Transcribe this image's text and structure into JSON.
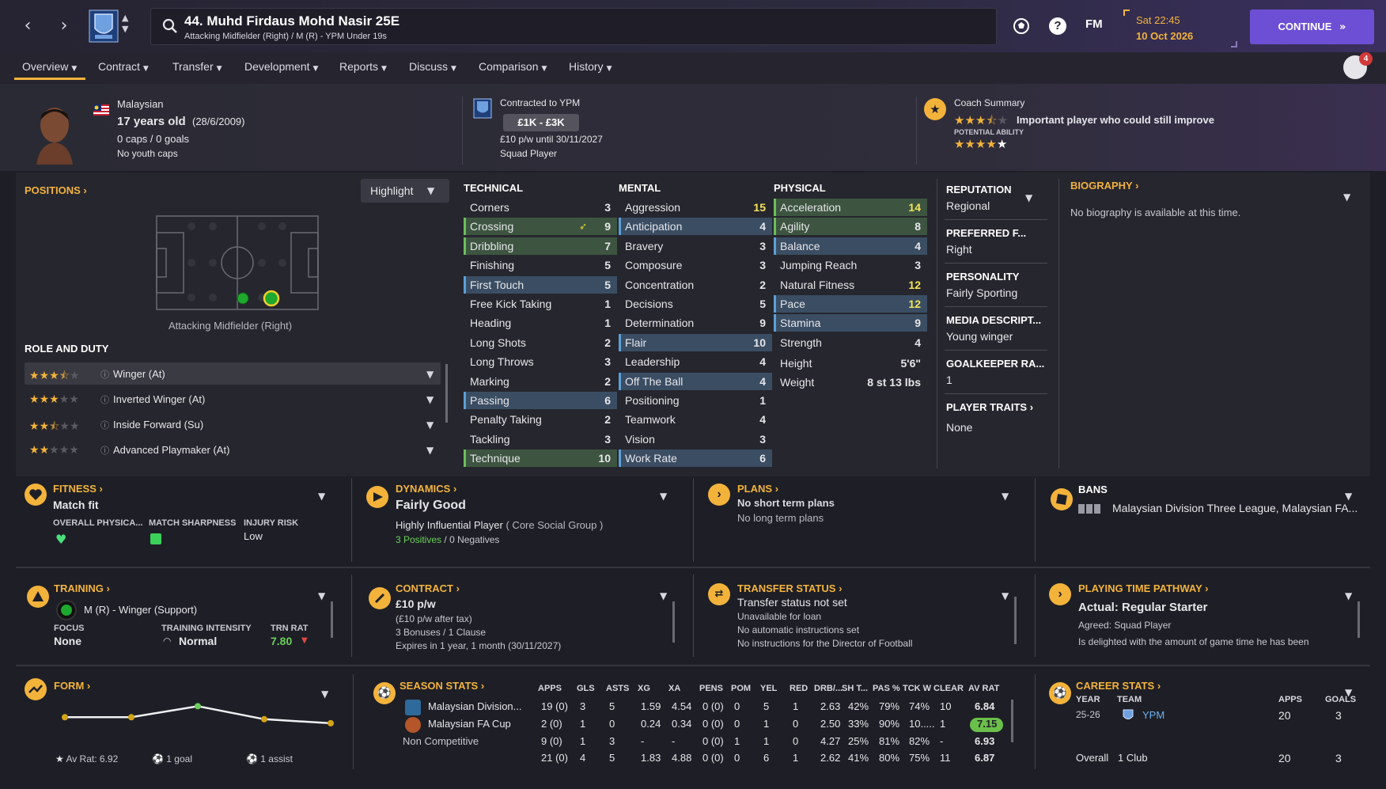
{
  "topbar": {
    "player_title": "44. Muhd Firdaus Mohd Nasir 25E",
    "player_subtitle": "Attacking Midfielder (Right) / M (R) - YPM Under 19s",
    "fm_label": "FM",
    "help_label": "?",
    "date_time": "Sat 22:45",
    "date": "10 Oct 2026",
    "continue_label": "CONTINUE",
    "notifications": "4"
  },
  "tabs": [
    {
      "label": "Overview"
    },
    {
      "label": "Contract"
    },
    {
      "label": "Transfer"
    },
    {
      "label": "Development"
    },
    {
      "label": "Reports"
    },
    {
      "label": "Discuss"
    },
    {
      "label": "Comparison"
    },
    {
      "label": "History"
    }
  ],
  "header": {
    "nationality": "Malaysian",
    "age": "17 years old",
    "dob": "(28/6/2009)",
    "caps": "0 caps / 0 goals",
    "youth_caps": "No youth caps",
    "contract_label": "Contracted to YPM",
    "value": "£1K - £3K",
    "wage": "£10 p/w until 30/11/2027",
    "squad_status": "Squad Player",
    "coach_summary_label": "Coach Summary",
    "coach_summary_text": "Important player who could still improve",
    "potential_label": "POTENTIAL ABILITY",
    "current_stars": 3.5,
    "potential_stars": 4.5
  },
  "positions": {
    "title": "POSITIONS",
    "highlight_label": "Highlight",
    "position_label": "Attacking Midfielder (Right)",
    "role_duty_title": "ROLE AND DUTY",
    "roles": [
      {
        "name": "Winger (At)",
        "stars": 3.5
      },
      {
        "name": "Inverted Winger (At)",
        "stars": 3
      },
      {
        "name": "Inside Forward (Su)",
        "stars": 2.5
      },
      {
        "name": "Advanced Playmaker (At)",
        "stars": 2
      }
    ]
  },
  "attributes": {
    "technical_title": "TECHNICAL",
    "mental_title": "MENTAL",
    "physical_title": "PHYSICAL",
    "technical": [
      {
        "name": "Corners",
        "value": "3"
      },
      {
        "name": "Crossing",
        "value": "9"
      },
      {
        "name": "Dribbling",
        "value": "7"
      },
      {
        "name": "Finishing",
        "value": "5"
      },
      {
        "name": "First Touch",
        "value": "5"
      },
      {
        "name": "Free Kick Taking",
        "value": "1"
      },
      {
        "name": "Heading",
        "value": "1"
      },
      {
        "name": "Long Shots",
        "value": "2"
      },
      {
        "name": "Long Throws",
        "value": "3"
      },
      {
        "name": "Marking",
        "value": "2"
      },
      {
        "name": "Passing",
        "value": "6"
      },
      {
        "name": "Penalty Taking",
        "value": "2"
      },
      {
        "name": "Tackling",
        "value": "3"
      },
      {
        "name": "Technique",
        "value": "10"
      }
    ],
    "mental": [
      {
        "name": "Aggression",
        "value": "15"
      },
      {
        "name": "Anticipation",
        "value": "4"
      },
      {
        "name": "Bravery",
        "value": "3"
      },
      {
        "name": "Composure",
        "value": "3"
      },
      {
        "name": "Concentration",
        "value": "2"
      },
      {
        "name": "Decisions",
        "value": "5"
      },
      {
        "name": "Determination",
        "value": "9"
      },
      {
        "name": "Flair",
        "value": "10"
      },
      {
        "name": "Leadership",
        "value": "4"
      },
      {
        "name": "Off The Ball",
        "value": "4"
      },
      {
        "name": "Positioning",
        "value": "1"
      },
      {
        "name": "Teamwork",
        "value": "4"
      },
      {
        "name": "Vision",
        "value": "3"
      },
      {
        "name": "Work Rate",
        "value": "6"
      }
    ],
    "physical": [
      {
        "name": "Acceleration",
        "value": "14"
      },
      {
        "name": "Agility",
        "value": "8"
      },
      {
        "name": "Balance",
        "value": "4"
      },
      {
        "name": "Jumping Reach",
        "value": "3"
      },
      {
        "name": "Natural Fitness",
        "value": "12"
      },
      {
        "name": "Pace",
        "value": "12"
      },
      {
        "name": "Stamina",
        "value": "9"
      },
      {
        "name": "Strength",
        "value": "4"
      }
    ],
    "height_label": "Height",
    "height": "5'6\"",
    "weight_label": "Weight",
    "weight": "8 st 13 lbs"
  },
  "info": {
    "reputation_label": "REPUTATION",
    "reputation": "Regional",
    "pref_foot_label": "PREFERRED F...",
    "pref_foot": "Right",
    "personality_label": "PERSONALITY",
    "personality": "Fairly Sporting",
    "media_label": "MEDIA DESCRIPT...",
    "media": "Young winger",
    "gk_label": "GOALKEEPER RA...",
    "gk": "1",
    "traits_label": "PLAYER TRAITS",
    "traits": "None",
    "biography_label": "BIOGRAPHY",
    "biography": "No biography is available at this time."
  },
  "fitness": {
    "title": "FITNESS",
    "status": "Match fit",
    "overall_label": "OVERALL PHYSICA...",
    "sharpness_label": "MATCH SHARPNESS",
    "injury_label": "INJURY RISK",
    "injury": "Low"
  },
  "dynamics": {
    "title": "DYNAMICS",
    "status": "Fairly Good",
    "influence": "Highly Influential Player",
    "group": "( Core Social Group )",
    "positives": "3 Positives",
    "slash": "/",
    "negatives": "0 Negatives"
  },
  "plans": {
    "title": "PLANS",
    "short": "No short term plans",
    "long": "No long term plans"
  },
  "bans": {
    "title": "BANS",
    "text": "Malaysian Division Three League, Malaysian FA..."
  },
  "training": {
    "title": "TRAINING",
    "role": "M (R) - Winger (Support)",
    "focus_label": "FOCUS",
    "focus": "None",
    "intensity_label": "TRAINING INTENSITY",
    "intensity": "Normal",
    "rating_label": "TRN RAT",
    "rating": "7.80"
  },
  "contract": {
    "title": "CONTRACT",
    "wage": "£10 p/w",
    "after_tax": "(£10 p/w after tax)",
    "bonuses": "3 Bonuses / 1 Clause",
    "expires": "Expires in 1 year, 1 month (30/11/2027)"
  },
  "transfer": {
    "title": "TRANSFER STATUS",
    "status": "Transfer status not set",
    "loan": "Unavailable for loan",
    "auto": "No automatic instructions set",
    "dof": "No instructions for the Director of Football"
  },
  "playing_time": {
    "title": "PLAYING TIME PATHWAY",
    "actual": "Actual: Regular Starter",
    "agreed": "Agreed:  Squad Player",
    "note": "Is delighted with the amount of game time he has been"
  },
  "form": {
    "title": "FORM",
    "av_rat": "Av Rat: 6.92",
    "goals": "1 goal",
    "assists": "1 assist",
    "points": [
      6.84,
      6.84,
      6.95,
      6.82,
      6.78
    ],
    "colors": {
      "line": "#f0f0f4",
      "point": "#d4a418",
      "best": "#6bd05a"
    }
  },
  "season_stats": {
    "title": "SEASON STATS",
    "headers": [
      "APPS",
      "GLS",
      "ASTS",
      "XG",
      "XA",
      "PENS",
      "POM",
      "YEL",
      "RED",
      "DRB/...",
      "SH T...",
      "PAS %",
      "TCK W",
      "CLEAR",
      "AV RAT"
    ],
    "rows": [
      {
        "comp": "Malaysian Division...",
        "cells": [
          "19 (0)",
          "3",
          "5",
          "1.59",
          "4.54",
          "0 (0)",
          "0",
          "5",
          "1",
          "2.63",
          "42%",
          "79%",
          "74%",
          "10",
          "6.84"
        ]
      },
      {
        "comp": "Malaysian FA Cup",
        "cells": [
          "2 (0)",
          "1",
          "0",
          "0.24",
          "0.34",
          "0 (0)",
          "0",
          "1",
          "0",
          "2.50",
          "33%",
          "90%",
          "10.....",
          "1",
          "7.15"
        ]
      },
      {
        "comp": "Non Competitive",
        "cells": [
          "9 (0)",
          "1",
          "3",
          "-",
          "-",
          "0 (0)",
          "1",
          "1",
          "0",
          "4.27",
          "25%",
          "81%",
          "82%",
          "-",
          "6.93"
        ]
      },
      {
        "comp": "",
        "cells": [
          "21 (0)",
          "4",
          "5",
          "1.83",
          "4.88",
          "0 (0)",
          "0",
          "6",
          "1",
          "2.62",
          "41%",
          "80%",
          "75%",
          "11",
          "6.87"
        ]
      }
    ]
  },
  "career_stats": {
    "title": "CAREER STATS",
    "year_label": "YEAR",
    "team_label": "TEAM",
    "apps_label": "APPS",
    "goals_label": "GOALS",
    "year": "25-26",
    "team": "YPM",
    "apps": "20",
    "goals": "3",
    "overall_label": "Overall",
    "overall_clubs": "1 Club",
    "overall_apps": "20",
    "overall_goals": "3"
  }
}
